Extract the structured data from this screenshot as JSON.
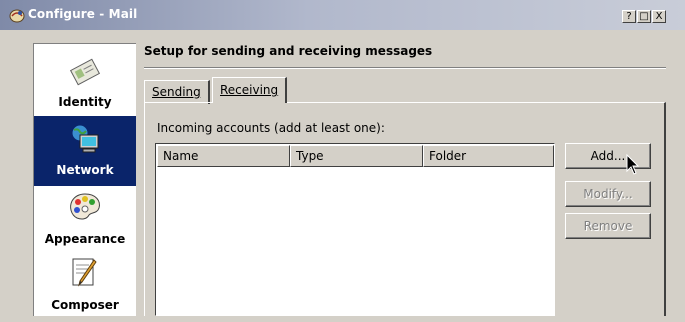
{
  "window": {
    "title": "Configure - Mail",
    "controls": {
      "help": "?",
      "minimize": "□",
      "close": "X"
    }
  },
  "sidebar": {
    "items": [
      {
        "label": "Identity",
        "icon": "identity-card-icon",
        "selected": false
      },
      {
        "label": "Network",
        "icon": "network-computer-icon",
        "selected": true
      },
      {
        "label": "Appearance",
        "icon": "palette-icon",
        "selected": false
      },
      {
        "label": "Composer",
        "icon": "compose-pencil-icon",
        "selected": false
      }
    ]
  },
  "main": {
    "heading": "Setup for sending and receiving messages",
    "tabs": [
      {
        "label": "Sending",
        "active": false
      },
      {
        "label": "Receiving",
        "active": true
      }
    ],
    "incoming_label": "Incoming accounts (add at least one):",
    "columns": [
      "Name",
      "Type",
      "Folder"
    ],
    "rows": [],
    "buttons": {
      "add": "Add...",
      "modify": "Modify...",
      "remove": "Remove"
    }
  },
  "colors": {
    "selection": "#0a246a",
    "face": "#d4d0c8",
    "titlebar_start": "#7f8aa8"
  }
}
